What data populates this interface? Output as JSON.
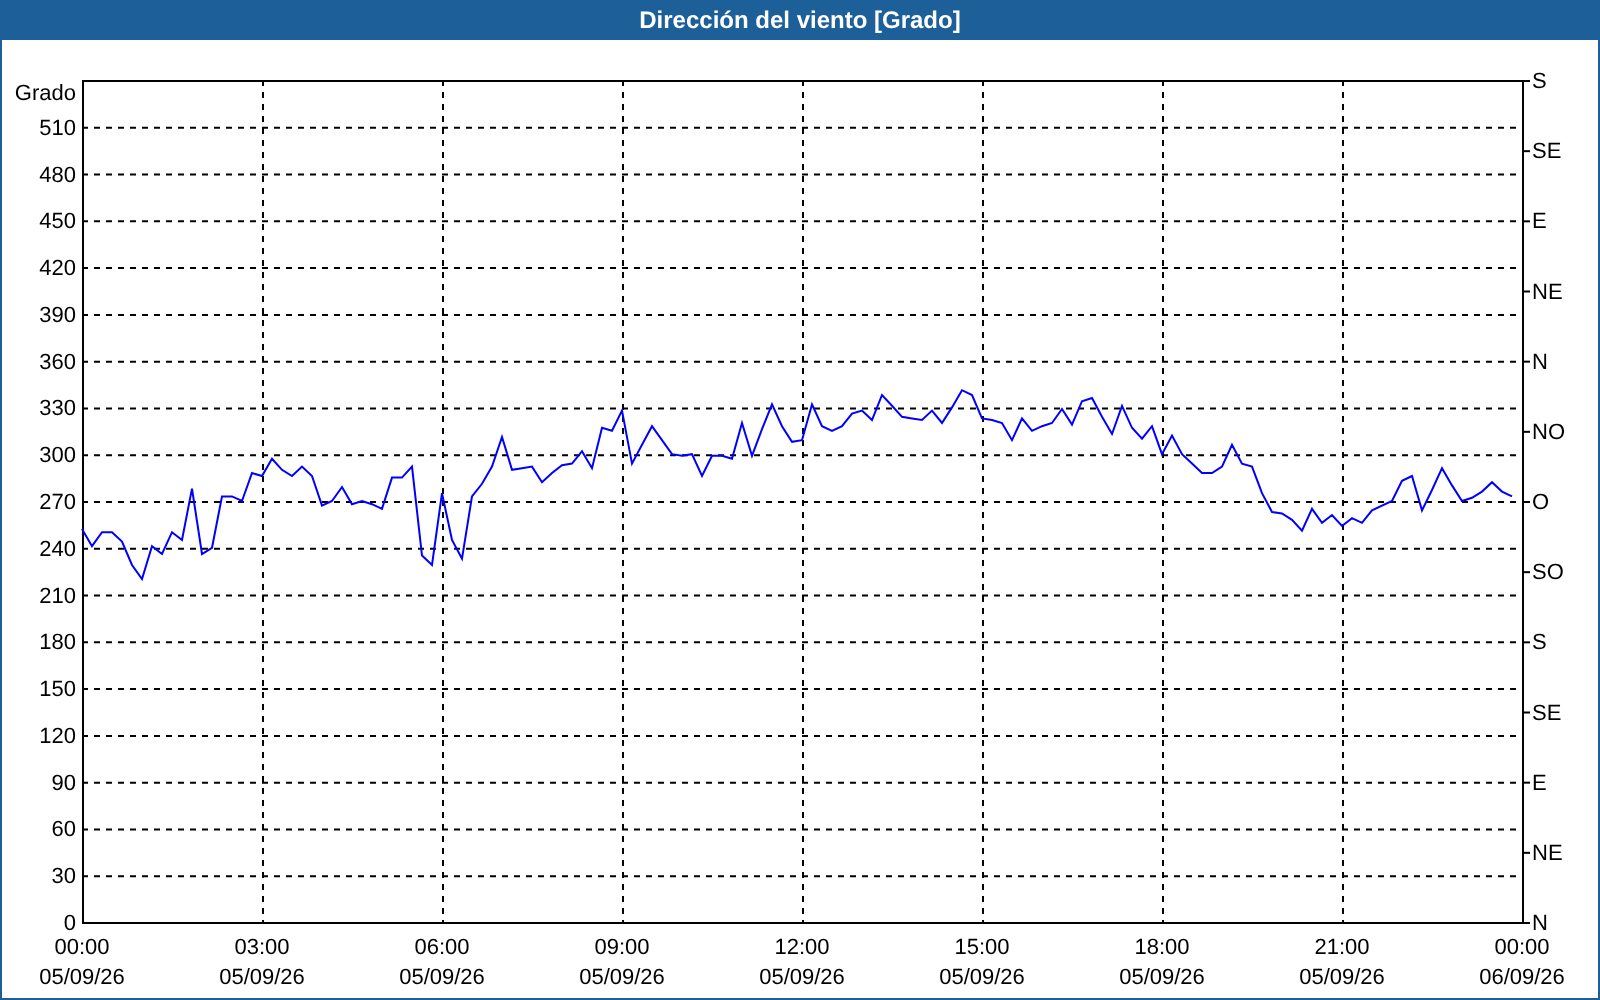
{
  "chart_data": {
    "type": "line",
    "title": "Dirección del viento [Grado]",
    "ylabel": "Grado",
    "categories": [
      "00:00\n05/09/26",
      null,
      null,
      null,
      null,
      null,
      null,
      null,
      null,
      null,
      null,
      null,
      null,
      null,
      null,
      null,
      null,
      null,
      "03:00\n05/09/26",
      null,
      null,
      null,
      null,
      null,
      null,
      null,
      null,
      null,
      null,
      null,
      null,
      null,
      null,
      null,
      null,
      null,
      "06:00\n05/09/26",
      null,
      null,
      null,
      null,
      null,
      null,
      null,
      null,
      null,
      null,
      null,
      null,
      null,
      null,
      null,
      null,
      null,
      "09:00\n05/09/26",
      null,
      null,
      null,
      null,
      null,
      null,
      null,
      null,
      null,
      null,
      null,
      null,
      null,
      null,
      null,
      null,
      null,
      "12:00\n05/09/26",
      null,
      null,
      null,
      null,
      null,
      null,
      null,
      null,
      null,
      null,
      null,
      null,
      null,
      null,
      null,
      null,
      null,
      "15:00\n05/09/26",
      null,
      null,
      null,
      null,
      null,
      null,
      null,
      null,
      null,
      null,
      null,
      null,
      null,
      null,
      null,
      null,
      null,
      "18:00\n05/09/26",
      null,
      null,
      null,
      null,
      null,
      null,
      null,
      null,
      null,
      null,
      null,
      null,
      null,
      null,
      null,
      null,
      null,
      "21:00\n05/09/26",
      null,
      null,
      null,
      null,
      null,
      null,
      null,
      null,
      null,
      null,
      null,
      null,
      null,
      null,
      null,
      null,
      null,
      "00:00\n06/09/26"
    ],
    "series": [
      {
        "color": "#0000ff",
        "values": [
          252,
          241,
          250,
          250,
          244,
          229,
          220,
          241,
          236,
          250,
          245,
          278,
          236,
          240,
          273,
          273,
          270,
          288,
          286,
          297,
          290,
          286,
          292,
          286,
          267,
          270,
          279,
          268,
          270,
          268,
          265,
          285,
          285,
          292,
          235,
          229,
          275,
          245,
          233,
          273,
          281,
          292,
          311,
          290,
          291,
          292,
          282,
          288,
          293,
          294,
          302,
          291,
          317,
          315,
          328,
          294,
          306,
          318,
          309,
          300,
          299,
          300,
          286,
          299,
          299,
          297,
          320,
          299,
          316,
          332,
          318,
          308,
          309,
          332,
          318,
          315,
          318,
          326,
          328,
          322,
          338,
          331,
          324,
          323,
          322,
          328,
          320,
          330,
          341,
          338,
          323,
          322,
          320,
          309,
          323,
          315,
          318,
          320,
          329,
          319,
          334,
          336,
          324,
          313,
          331,
          317,
          310,
          318,
          300,
          312,
          300,
          294,
          288,
          288,
          292,
          306,
          294,
          292,
          275,
          263,
          262,
          258,
          251,
          265,
          256,
          261,
          254,
          259,
          256,
          264,
          267,
          270,
          283,
          286,
          264,
          277,
          291,
          280,
          270,
          272,
          276,
          282,
          276,
          273,
          null
        ]
      }
    ],
    "ylim": [
      0,
      540
    ],
    "grid": true,
    "yticks": [
      0,
      30,
      60,
      90,
      120,
      150,
      180,
      210,
      240,
      270,
      300,
      330,
      360,
      390,
      420,
      450,
      480,
      510
    ]
  },
  "compass_labels": [
    "S",
    "SE",
    "E",
    "NE",
    "N",
    "NO",
    "O",
    "SO",
    "S",
    "SE",
    "E",
    "NE",
    "N"
  ]
}
